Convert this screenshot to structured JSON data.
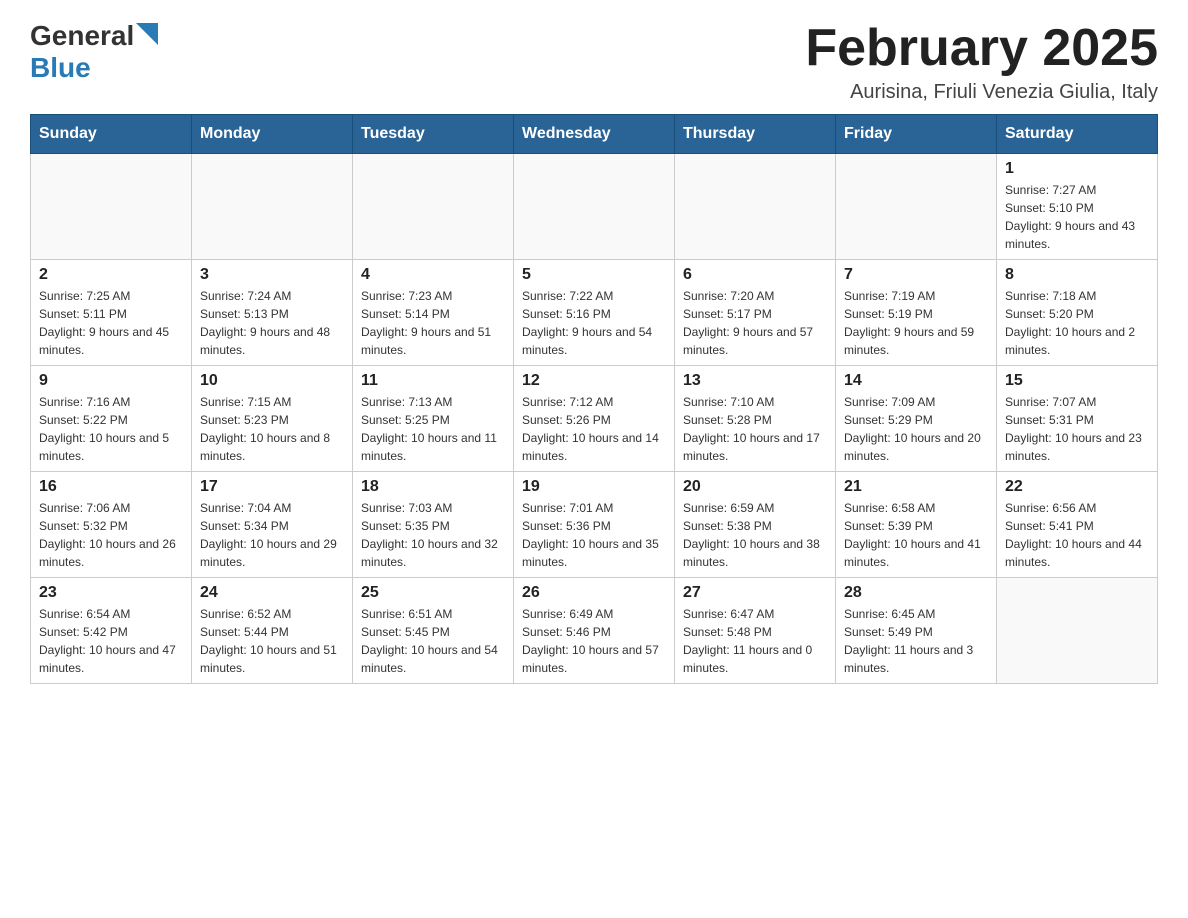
{
  "header": {
    "logo_general": "General",
    "logo_blue": "Blue",
    "title": "February 2025",
    "subtitle": "Aurisina, Friuli Venezia Giulia, Italy"
  },
  "calendar": {
    "days_of_week": [
      "Sunday",
      "Monday",
      "Tuesday",
      "Wednesday",
      "Thursday",
      "Friday",
      "Saturday"
    ],
    "weeks": [
      [
        {
          "day": "",
          "info": ""
        },
        {
          "day": "",
          "info": ""
        },
        {
          "day": "",
          "info": ""
        },
        {
          "day": "",
          "info": ""
        },
        {
          "day": "",
          "info": ""
        },
        {
          "day": "",
          "info": ""
        },
        {
          "day": "1",
          "info": "Sunrise: 7:27 AM\nSunset: 5:10 PM\nDaylight: 9 hours and 43 minutes."
        }
      ],
      [
        {
          "day": "2",
          "info": "Sunrise: 7:25 AM\nSunset: 5:11 PM\nDaylight: 9 hours and 45 minutes."
        },
        {
          "day": "3",
          "info": "Sunrise: 7:24 AM\nSunset: 5:13 PM\nDaylight: 9 hours and 48 minutes."
        },
        {
          "day": "4",
          "info": "Sunrise: 7:23 AM\nSunset: 5:14 PM\nDaylight: 9 hours and 51 minutes."
        },
        {
          "day": "5",
          "info": "Sunrise: 7:22 AM\nSunset: 5:16 PM\nDaylight: 9 hours and 54 minutes."
        },
        {
          "day": "6",
          "info": "Sunrise: 7:20 AM\nSunset: 5:17 PM\nDaylight: 9 hours and 57 minutes."
        },
        {
          "day": "7",
          "info": "Sunrise: 7:19 AM\nSunset: 5:19 PM\nDaylight: 9 hours and 59 minutes."
        },
        {
          "day": "8",
          "info": "Sunrise: 7:18 AM\nSunset: 5:20 PM\nDaylight: 10 hours and 2 minutes."
        }
      ],
      [
        {
          "day": "9",
          "info": "Sunrise: 7:16 AM\nSunset: 5:22 PM\nDaylight: 10 hours and 5 minutes."
        },
        {
          "day": "10",
          "info": "Sunrise: 7:15 AM\nSunset: 5:23 PM\nDaylight: 10 hours and 8 minutes."
        },
        {
          "day": "11",
          "info": "Sunrise: 7:13 AM\nSunset: 5:25 PM\nDaylight: 10 hours and 11 minutes."
        },
        {
          "day": "12",
          "info": "Sunrise: 7:12 AM\nSunset: 5:26 PM\nDaylight: 10 hours and 14 minutes."
        },
        {
          "day": "13",
          "info": "Sunrise: 7:10 AM\nSunset: 5:28 PM\nDaylight: 10 hours and 17 minutes."
        },
        {
          "day": "14",
          "info": "Sunrise: 7:09 AM\nSunset: 5:29 PM\nDaylight: 10 hours and 20 minutes."
        },
        {
          "day": "15",
          "info": "Sunrise: 7:07 AM\nSunset: 5:31 PM\nDaylight: 10 hours and 23 minutes."
        }
      ],
      [
        {
          "day": "16",
          "info": "Sunrise: 7:06 AM\nSunset: 5:32 PM\nDaylight: 10 hours and 26 minutes."
        },
        {
          "day": "17",
          "info": "Sunrise: 7:04 AM\nSunset: 5:34 PM\nDaylight: 10 hours and 29 minutes."
        },
        {
          "day": "18",
          "info": "Sunrise: 7:03 AM\nSunset: 5:35 PM\nDaylight: 10 hours and 32 minutes."
        },
        {
          "day": "19",
          "info": "Sunrise: 7:01 AM\nSunset: 5:36 PM\nDaylight: 10 hours and 35 minutes."
        },
        {
          "day": "20",
          "info": "Sunrise: 6:59 AM\nSunset: 5:38 PM\nDaylight: 10 hours and 38 minutes."
        },
        {
          "day": "21",
          "info": "Sunrise: 6:58 AM\nSunset: 5:39 PM\nDaylight: 10 hours and 41 minutes."
        },
        {
          "day": "22",
          "info": "Sunrise: 6:56 AM\nSunset: 5:41 PM\nDaylight: 10 hours and 44 minutes."
        }
      ],
      [
        {
          "day": "23",
          "info": "Sunrise: 6:54 AM\nSunset: 5:42 PM\nDaylight: 10 hours and 47 minutes."
        },
        {
          "day": "24",
          "info": "Sunrise: 6:52 AM\nSunset: 5:44 PM\nDaylight: 10 hours and 51 minutes."
        },
        {
          "day": "25",
          "info": "Sunrise: 6:51 AM\nSunset: 5:45 PM\nDaylight: 10 hours and 54 minutes."
        },
        {
          "day": "26",
          "info": "Sunrise: 6:49 AM\nSunset: 5:46 PM\nDaylight: 10 hours and 57 minutes."
        },
        {
          "day": "27",
          "info": "Sunrise: 6:47 AM\nSunset: 5:48 PM\nDaylight: 11 hours and 0 minutes."
        },
        {
          "day": "28",
          "info": "Sunrise: 6:45 AM\nSunset: 5:49 PM\nDaylight: 11 hours and 3 minutes."
        },
        {
          "day": "",
          "info": ""
        }
      ]
    ]
  }
}
